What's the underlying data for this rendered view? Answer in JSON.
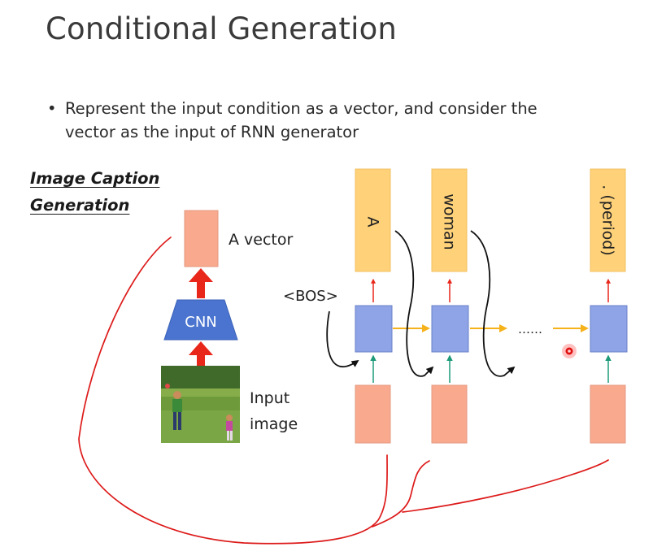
{
  "slide": {
    "title": "Conditional Generation",
    "bullet": "Represent the input condition as a vector, and consider the vector as the input of RNN generator",
    "bullet_line1": "Represent the input condition as a vector, and consider the",
    "bullet_line2": "vector as the input of RNN generator",
    "side_title_line1": "Image Caption",
    "side_title_line2": "Generation"
  },
  "diagram": {
    "vector_label": "A vector",
    "cnn_label": "CNN",
    "input_label_line1": "Input",
    "input_label_line2": "image",
    "bos_label": "<BOS>",
    "ellipsis": "……",
    "outputs": [
      "A",
      "woman",
      ". (period)"
    ]
  },
  "colors": {
    "salmon": "#f8a98e",
    "rnn_blue": "#8ea4e6",
    "output_yellow": "#ffd27a",
    "cnn_blue": "#4a74cf",
    "arrow_red": "#e8261a",
    "arrow_orange": "#f5b21a",
    "arrow_green": "#1e9a7a",
    "annotation_red": "#dd1a1a"
  }
}
